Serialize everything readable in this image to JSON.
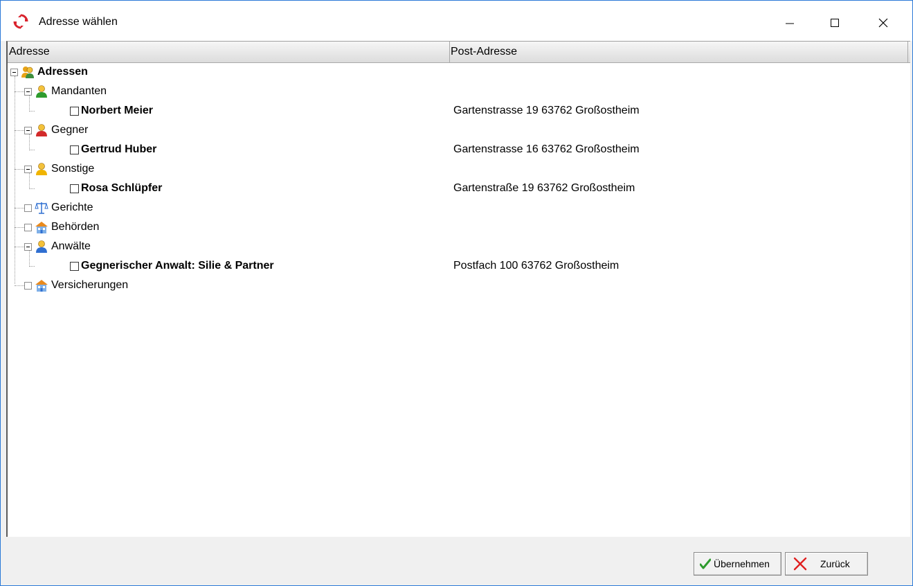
{
  "window": {
    "title": "Adresse wählen"
  },
  "controls": {
    "minimize": "—",
    "maximize": "☐",
    "close": "✕"
  },
  "columns": [
    "Adresse",
    "Post-Adresse"
  ],
  "tree": [
    {
      "label": "Adressen",
      "post": "",
      "level": 0,
      "kind": "group",
      "icon": "people-group-icon",
      "bold": true
    },
    {
      "label": "Mandanten",
      "post": "",
      "level": 1,
      "kind": "group",
      "icon": "person-green-icon",
      "bold": false
    },
    {
      "label": "Norbert Meier",
      "post": "Gartenstrasse 19 63762 Großostheim",
      "level": 2,
      "kind": "entry",
      "bold": true
    },
    {
      "label": "Gegner",
      "post": "",
      "level": 1,
      "kind": "group",
      "icon": "person-red-icon",
      "bold": false
    },
    {
      "label": "Gertrud Huber",
      "post": "Gartenstrasse 16 63762 Großostheim",
      "level": 2,
      "kind": "entry",
      "bold": true
    },
    {
      "label": "Sonstige",
      "post": "",
      "level": 1,
      "kind": "group",
      "icon": "person-yellow-icon",
      "bold": false
    },
    {
      "label": "Rosa Schlüpfer",
      "post": "Gartenstraße 19 63762 Großostheim",
      "level": 2,
      "kind": "entry",
      "bold": true
    },
    {
      "label": "Gerichte",
      "post": "",
      "level": 1,
      "kind": "leafgroup",
      "icon": "scales-icon",
      "bold": false
    },
    {
      "label": "Behörden",
      "post": "",
      "level": 1,
      "kind": "leafgroup",
      "icon": "building-icon",
      "bold": false
    },
    {
      "label": "Anwälte",
      "post": "",
      "level": 1,
      "kind": "group",
      "icon": "person-blue-icon",
      "bold": false
    },
    {
      "label": "Gegnerischer Anwalt: Silie & Partner",
      "post": "Postfach 100 63762 Großostheim",
      "level": 2,
      "kind": "entry",
      "bold": true
    },
    {
      "label": "Versicherungen",
      "post": "",
      "level": 1,
      "kind": "leafgroup",
      "icon": "building-icon",
      "bold": false
    }
  ],
  "buttons": {
    "ok": "Übernehmen",
    "back": "Zurück"
  }
}
